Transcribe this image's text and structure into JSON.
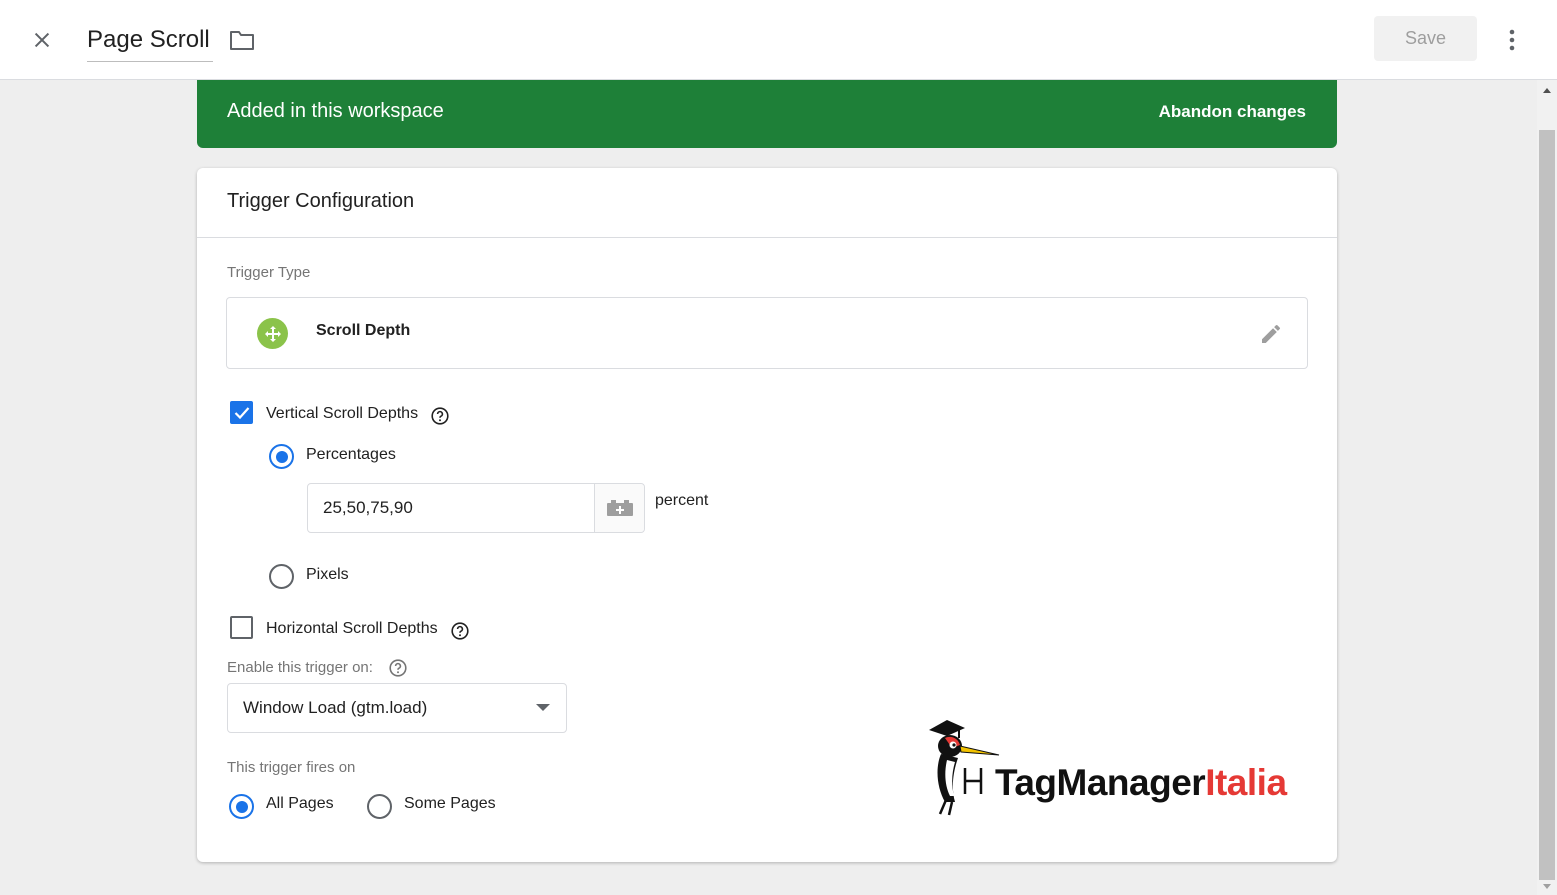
{
  "topbar": {
    "title": "Page Scroll",
    "save_label": "Save"
  },
  "banner": {
    "text": "Added in this workspace",
    "action": "Abandon changes",
    "color": "#1e8038"
  },
  "card": {
    "title": "Trigger Configuration",
    "trigger_type_label": "Trigger Type",
    "trigger_type": {
      "name": "Scroll Depth",
      "icon": "scroll-depth-icon",
      "icon_color": "#8bc34a"
    },
    "vertical": {
      "label": "Vertical Scroll Depths",
      "checked": true,
      "options": {
        "percentages_label": "Percentages",
        "pixels_label": "Pixels",
        "selected": "Percentages"
      },
      "value": "25,50,75,90",
      "unit": "percent"
    },
    "horizontal": {
      "label": "Horizontal Scroll Depths",
      "checked": false
    },
    "enable_on": {
      "label": "Enable this trigger on:",
      "value": "Window Load (gtm.load)"
    },
    "fires_on": {
      "label": "This trigger fires on",
      "options": [
        "All Pages",
        "Some Pages"
      ],
      "selected": "All Pages"
    }
  },
  "logo": {
    "text_dark": "TagManager",
    "text_red": "Italia"
  },
  "colors": {
    "accent": "#1a73e8",
    "brand_red": "#e53935"
  }
}
